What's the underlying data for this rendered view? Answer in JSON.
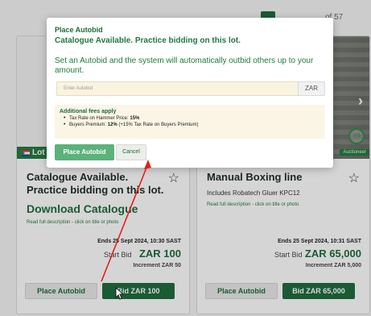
{
  "pager": {
    "text": "of 57"
  },
  "lots": [
    {
      "tag": "Lot",
      "title": "Catalogue Available. Practice bidding on this lot.",
      "download": "Download Catalogue",
      "read_full": "Read full description - click on title or photo",
      "ends": "Ends 25 Sept 2024, 10:30 SAST",
      "start_label": "Start Bid",
      "start_amount": "ZAR 100",
      "increment": "Increment ZAR 50",
      "autobid_label": "Place Autobid",
      "bid_label": "Bid ZAR 100"
    },
    {
      "auctioneer": "Auctioneer",
      "seal": "VII",
      "title": "Manual Boxing line",
      "subtitle": "Includes Robatech Gluer KPC12",
      "read_full": "Read full description - click on title or photo",
      "ends": "Ends 25 Sept 2024, 10:31 SAST",
      "start_label": "Start Bid",
      "start_amount": "ZAR 65,000",
      "increment": "Increment ZAR 5,000",
      "autobid_label": "Place Autobid",
      "bid_label": "Bid ZAR 65,000"
    }
  ],
  "modal": {
    "title": "Place Autobid",
    "subtitle": "Catalogue Available. Practice bidding on this lot.",
    "description": "Set an Autobid and the system will automatically outbid others up to your amount.",
    "input_placeholder": "Enter Autobid",
    "currency": "ZAR",
    "fees_title": "Additional fees apply",
    "fee_1_label": "Tax Rate on Hammer Price:",
    "fee_1_value": "15%",
    "fee_2_label": "Buyers Premium:",
    "fee_2_value": "12%",
    "fee_2_extra": "(+15% Tax Rate on Buyers Premium)",
    "place_label": "Place Autobid",
    "cancel_label": "Cancel"
  },
  "colors": {
    "brand_green": "#1b6b3a",
    "light_green": "#5bb27a",
    "fees_bg": "#fbf5e6",
    "arrow_red": "#e0201b"
  },
  "icons": [
    "star-icon",
    "chevron-right-icon",
    "flag-icon",
    "cursor-icon"
  ]
}
